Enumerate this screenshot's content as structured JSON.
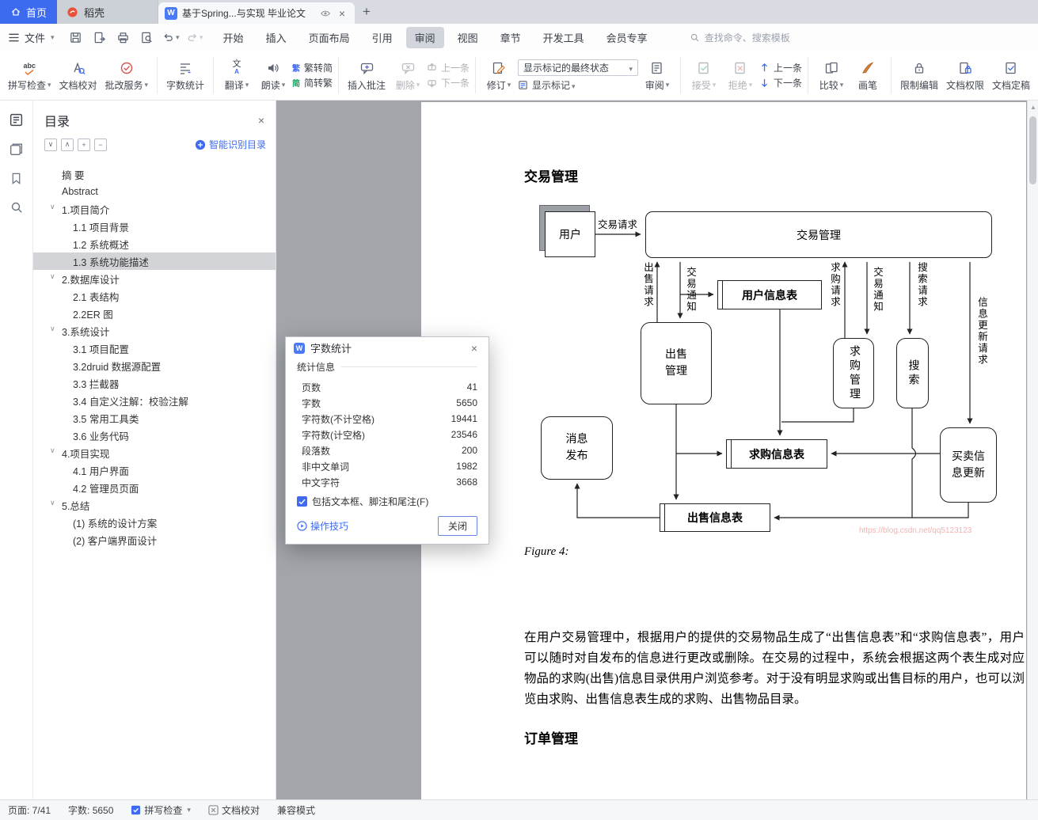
{
  "colors": {
    "accent": "#3e6bf2",
    "home_blue": "#3c6bf0",
    "docer_red": "#e8503a",
    "select_gray": "#d2d4d8"
  },
  "icons": {
    "w": "W",
    "close": "×",
    "plus": "+",
    "abc": "abc",
    "a": "A",
    "wen": "文",
    "a_small": "A",
    "fan": "繁",
    "jian": "简",
    "tool_collapse": "∨",
    "tool_expand": "∧",
    "tool_plus": "+",
    "tool_minus": "−",
    "sb_up": "▲"
  },
  "tabbar": {
    "home": "首页",
    "docer": "稻壳",
    "doc_title": "基于Spring...与实现 毕业论文"
  },
  "menubar": {
    "file": "文件",
    "tabs": [
      "开始",
      "插入",
      "页面布局",
      "引用",
      "审阅",
      "视图",
      "章节",
      "开发工具",
      "会员专享"
    ],
    "search": "查找命令、搜索模板"
  },
  "ribbon": {
    "spell": "拼写检查",
    "proof": "文档校对",
    "correction": "批改服务",
    "wordcount": "字数统计",
    "translate": "翻译",
    "read": "朗读",
    "t2s": "繁转简",
    "s2t": "简转繁",
    "insert_comment": "插入批注",
    "del": "删除",
    "prev_comment": "上一条",
    "next_comment": "下一条",
    "revise": "修订",
    "marks_state": "显示标记的最终状态",
    "show_marks": "显示标记",
    "review": "审阅",
    "accept": "接受",
    "reject": "拒绝",
    "prev_rev": "上一条",
    "next_rev": "下一条",
    "compare": "比较",
    "pen": "画笔",
    "restrict": "限制编辑",
    "permission": "文档权限",
    "finalize": "文档定稿"
  },
  "outline": {
    "title": "目录",
    "smart": "智能识别目录",
    "items": [
      {
        "label": "摘 要"
      },
      {
        "label": "Abstract"
      },
      {
        "label": "1.项目简介"
      },
      {
        "label": "1.1 项目背景"
      },
      {
        "label": "1.2 系统概述"
      },
      {
        "label": "1.3 系统功能描述"
      },
      {
        "label": "2.数据库设计"
      },
      {
        "label": "2.1 表结构"
      },
      {
        "label": "2.2ER 图"
      },
      {
        "label": "3.系统设计"
      },
      {
        "label": "3.1 项目配置"
      },
      {
        "label": "3.2druid 数据源配置"
      },
      {
        "label": "3.3 拦截器"
      },
      {
        "label": "3.4 自定义注解：校验注解"
      },
      {
        "label": "3.5 常用工具类"
      },
      {
        "label": "3.6 业务代码"
      },
      {
        "label": "4.项目实现"
      },
      {
        "label": "4.1 用户界面"
      },
      {
        "label": "4.2 管理员页面"
      },
      {
        "label": "5.总结"
      },
      {
        "label": "(1) 系统的设计方案"
      },
      {
        "label": "(2) 客户端界面设计"
      }
    ]
  },
  "document": {
    "heading1": "交易管理",
    "figure": "Figure 4:",
    "paragraph": "在用户交易管理中，根据用户的提供的交易物品生成了“出售信息表”和“求购信息表”，用户可以随时对自发布的信息进行更改或删除。在交易的过程中，系统会根据这两个表生成对应物品的求购(出售)信息目录供用户浏览参考。对于没有明显求购或出售目标的用户，也可以浏览由求购、出售信息表生成的求购、出售物品目录。",
    "heading2": "订单管理",
    "watermark": "https://blog.csdn.net/qq5123123"
  },
  "diagram": {
    "user": "用户",
    "trade": "交易管理",
    "user_table": "用户信息表",
    "sell": "出售管理",
    "buy": "求购管理",
    "search": "搜索",
    "publish": "消息发布",
    "buy_table": "求购信息表",
    "sell_table": "出售信息表",
    "update": "买卖信息更新",
    "lbl_trade_req": "交易请求",
    "lbl_sell_req": "出售请求",
    "lbl_notice1": "交易通知",
    "lbl_buy_req": "求购请求",
    "lbl_notice2": "交易通知",
    "lbl_search_req": "搜索请求",
    "lbl_update_req": "信息更新请求"
  },
  "dialog": {
    "title": "字数统计",
    "section": "统计信息",
    "rows": [
      {
        "label": "页数",
        "value": "41"
      },
      {
        "label": "字数",
        "value": "5650"
      },
      {
        "label": "字符数(不计空格)",
        "value": "19441"
      },
      {
        "label": "字符数(计空格)",
        "value": "23546"
      },
      {
        "label": "段落数",
        "value": "200"
      },
      {
        "label": "非中文单词",
        "value": "1982"
      },
      {
        "label": "中文字符",
        "value": "3668"
      }
    ],
    "checkbox": "包括文本框、脚注和尾注(F)",
    "tips": "操作技巧",
    "close": "关闭"
  },
  "statusbar": {
    "page": "页面: 7/41",
    "words": "字数: 5650",
    "spell": "拼写检查",
    "proof": "文档校对",
    "mode": "兼容模式"
  }
}
